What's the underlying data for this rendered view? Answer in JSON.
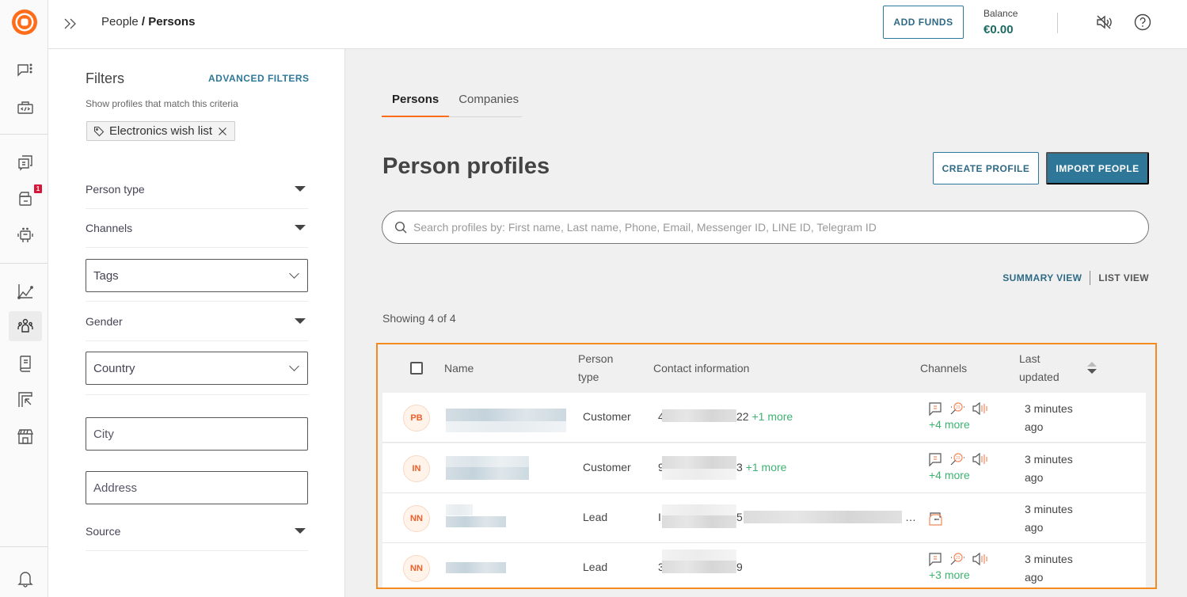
{
  "app": {
    "breadcrumb": {
      "parent": "People",
      "separator": " / ",
      "current": "Persons"
    },
    "accent_color": "#ff6c1a",
    "primary_color": "#2e7798"
  },
  "rail": {
    "items": [
      {
        "name": "conversations",
        "icon": "chat-options-icon"
      },
      {
        "name": "developer",
        "icon": "code-briefcase-icon"
      },
      {
        "name": "inbox",
        "icon": "chat-copy-icon"
      },
      {
        "name": "tickets",
        "icon": "ticket-stack-icon",
        "badge": "1"
      },
      {
        "name": "bots",
        "icon": "robot-icon"
      },
      {
        "name": "analytics",
        "icon": "line-chart-icon"
      },
      {
        "name": "people",
        "icon": "people-icon",
        "active": true
      },
      {
        "name": "knowledge",
        "icon": "book-icon"
      },
      {
        "name": "campaigns",
        "icon": "cursor-board-icon"
      },
      {
        "name": "store",
        "icon": "storefront-icon"
      },
      {
        "name": "notifications",
        "icon": "bell-icon"
      }
    ]
  },
  "topbar": {
    "add_funds": "ADD FUNDS",
    "balance_label": "Balance",
    "balance_value": "€0.00"
  },
  "filters": {
    "title": "Filters",
    "advanced": "ADVANCED FILTERS",
    "subtitle": "Show profiles that match this criteria",
    "active_chip": "Electronics wish list",
    "person_type": "Person type",
    "channels": "Channels",
    "tags": "Tags",
    "gender": "Gender",
    "country": "Country",
    "city_placeholder": "City",
    "address_placeholder": "Address",
    "source": "Source"
  },
  "main": {
    "tabs": [
      {
        "label": "Persons",
        "active": true
      },
      {
        "label": "Companies",
        "active": false
      }
    ],
    "title": "Person profiles",
    "create_profile": "CREATE PROFILE",
    "import_people": "IMPORT PEOPLE",
    "search_placeholder": "Search profiles by: First name, Last name, Phone, Email, Messenger ID, LINE ID, Telegram ID",
    "summary_view": "SUMMARY VIEW",
    "list_view": "LIST VIEW",
    "showing": "Showing 4 of 4"
  },
  "table": {
    "headers": {
      "name": "Name",
      "person_type_1": "Person",
      "person_type_2": "type",
      "contact": "Contact information",
      "channels": "Channels",
      "updated_1": "Last",
      "updated_2": "updated"
    },
    "rows": [
      {
        "initials": "PB",
        "type": "Customer",
        "contact_prefix": "4",
        "contact_suffix": "22",
        "contact_more": "+1 more",
        "channels": [
          "chat-icon",
          "search-23-icon",
          "speaker-icon"
        ],
        "channels_more": "+4 more",
        "updated_1": "3 minutes",
        "updated_2": "ago"
      },
      {
        "initials": "IN",
        "type": "Customer",
        "contact_prefix": "9",
        "contact_suffix": "3",
        "contact_more": "+1 more",
        "channels": [
          "chat-icon",
          "search-23-icon",
          "speaker-icon"
        ],
        "channels_more": "+4 more",
        "updated_1": "3 minutes",
        "updated_2": "ago"
      },
      {
        "initials": "NN",
        "type": "Lead",
        "contact_prefix": "I",
        "contact_suffix": "5",
        "contact_more": "…",
        "channels": [
          "webchat-icon"
        ],
        "channels_more": "",
        "updated_1": "3 minutes",
        "updated_2": "ago"
      },
      {
        "initials": "NN",
        "type": "Lead",
        "contact_prefix": "3",
        "contact_suffix": "9",
        "contact_more": "",
        "channels": [
          "chat-icon",
          "search-23-icon",
          "speaker-icon"
        ],
        "channels_more": "+3 more",
        "updated_1": "3 minutes",
        "updated_2": "ago"
      }
    ]
  }
}
